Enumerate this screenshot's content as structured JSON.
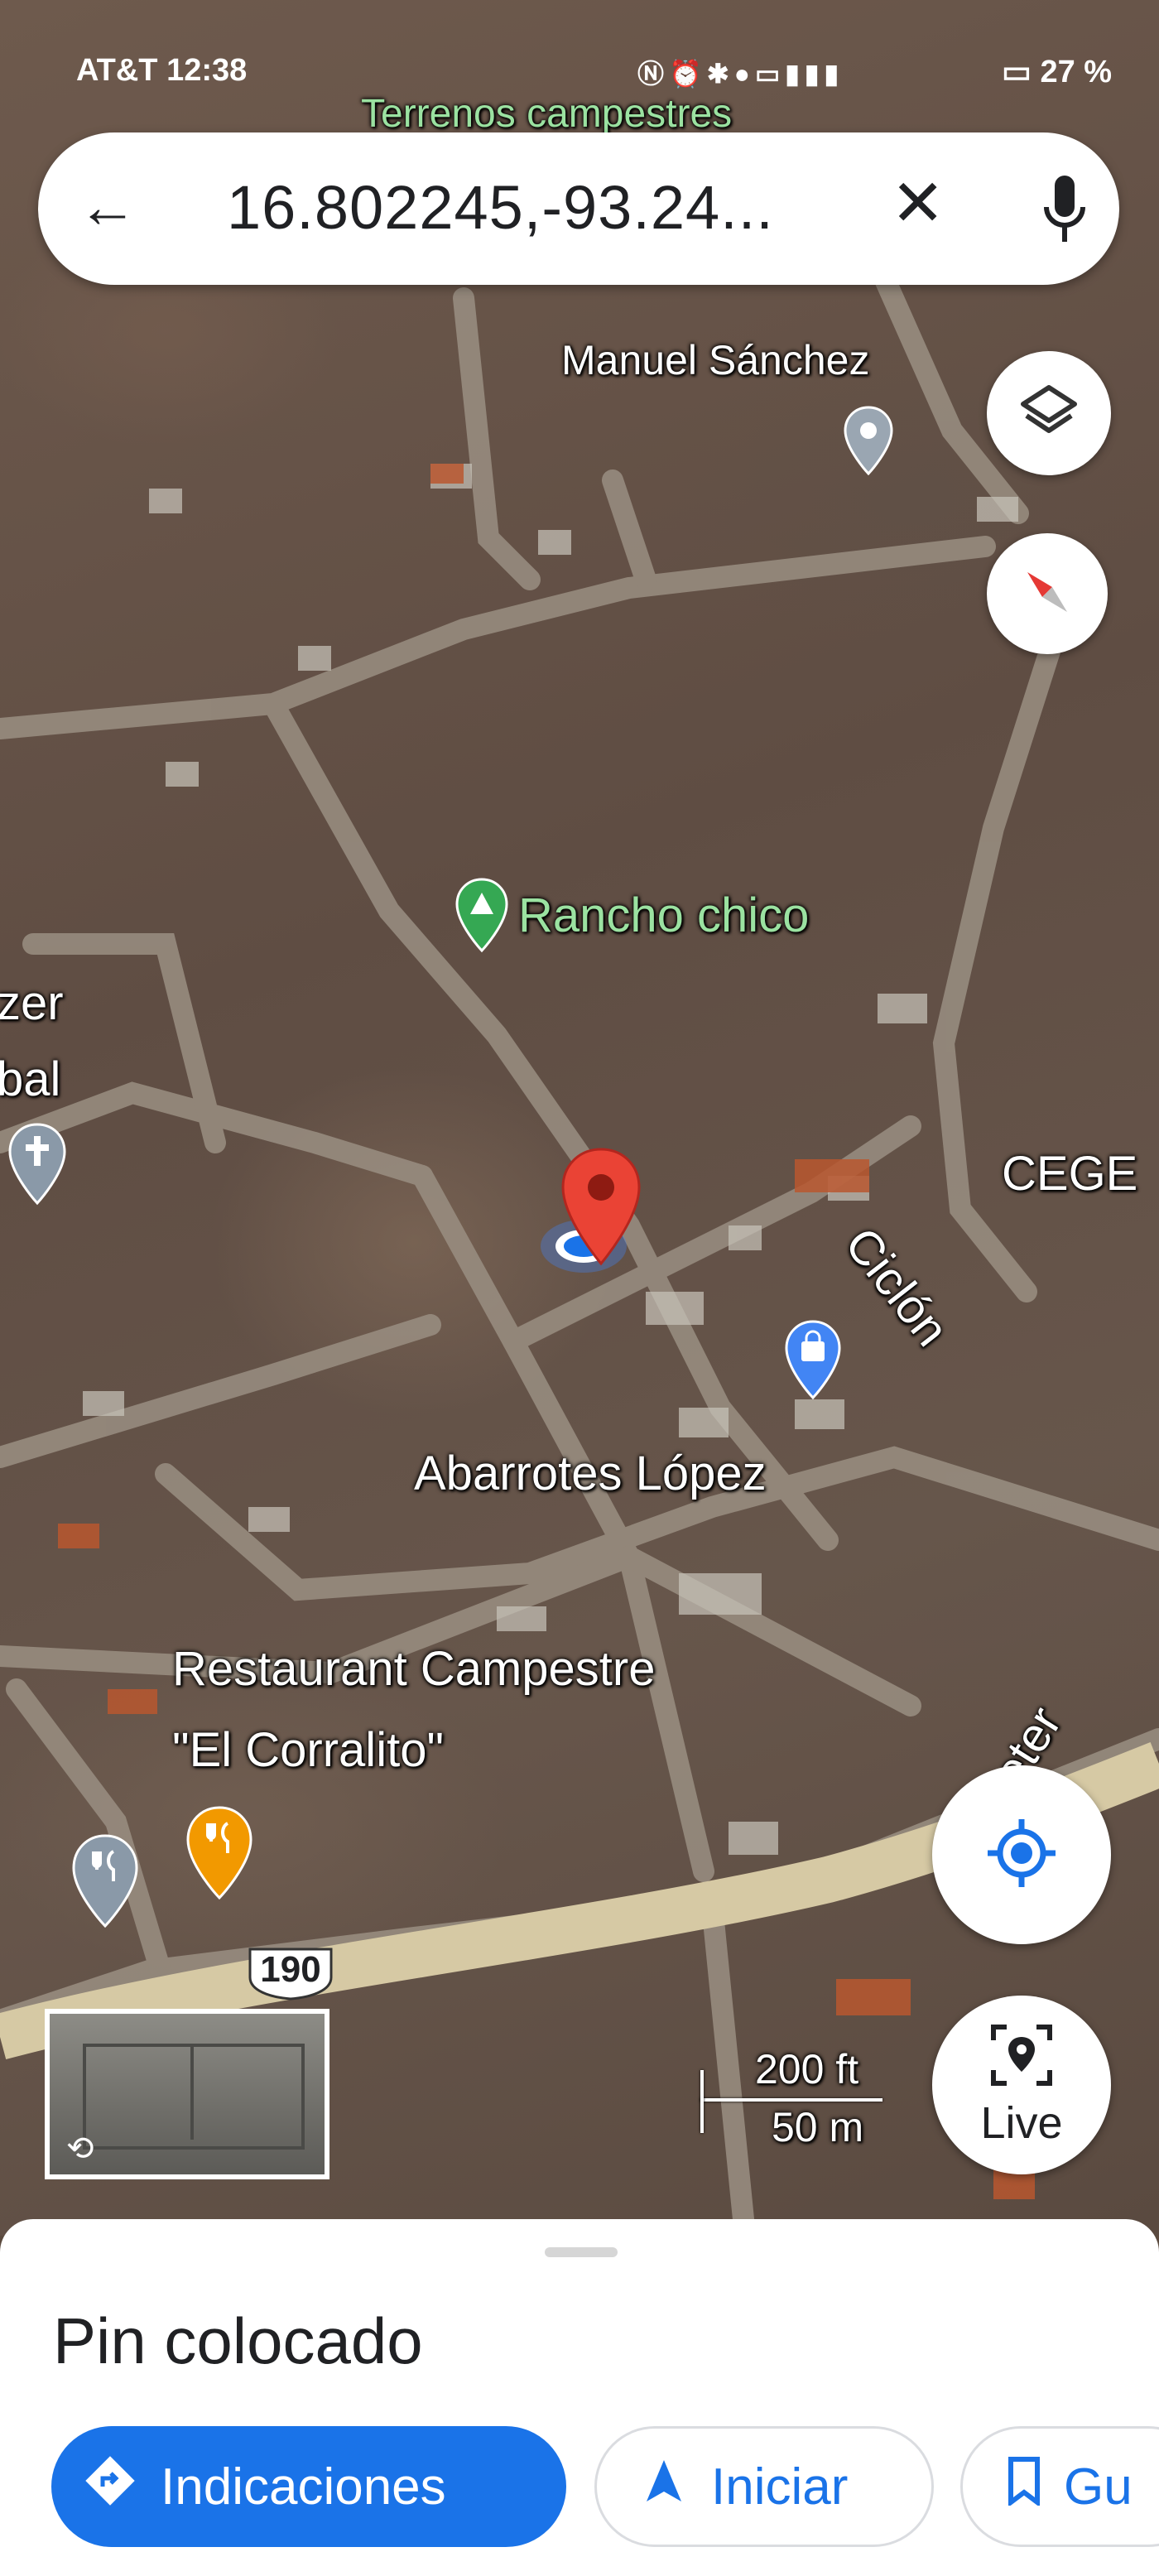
{
  "status_bar": {
    "carrier": "AT&T",
    "time": "12:38",
    "battery": "27 %"
  },
  "search": {
    "query": "16.802245,-93.24..."
  },
  "map": {
    "labels": {
      "top_partial": "Terrenos campestres",
      "manuel": "Manuel Sánchez",
      "rancho": "Rancho chico",
      "left_partial_1": "zer",
      "left_partial_2": "bal",
      "cegeo": "CEGE",
      "ciclon": "Ciclón",
      "abarrotes": "Abarrotes López",
      "restaurant_1": "Restaurant Campestre",
      "restaurant_2": "\"El Corralito\"",
      "carretera_partial": "Carreter",
      "highway": "190",
      "scale_ft": "200 ft",
      "scale_m": "50 m"
    },
    "live_label": "Live"
  },
  "sheet": {
    "title": "Pin colocado",
    "buttons": {
      "directions": "Indicaciones",
      "start": "Iniciar",
      "save": "Gu"
    }
  }
}
